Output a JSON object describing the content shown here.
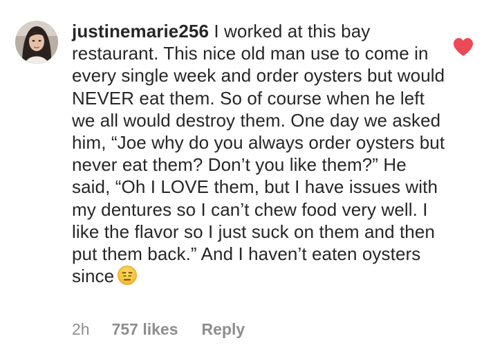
{
  "comment": {
    "username": "justinemarie256",
    "text": "I worked at this bay restaurant. This nice old man use to come in every single week and order oysters but would NEVER eat them. So of course when he left we all would destroy them. One day we asked him, “Joe why do you always order oysters but never eat them? Don’t you like them?” He said, “Oh I LOVE them, but I have issues with my dentures so I can’t chew food very well. I like the flavor so I just suck on them and then put them back.” And I haven’t eaten oysters since",
    "emoji_icon": "expressionless-face-emoji",
    "time": "2h",
    "likes": "757 likes",
    "reply_label": "Reply",
    "liked": true,
    "heart_color": "#ed4956"
  }
}
